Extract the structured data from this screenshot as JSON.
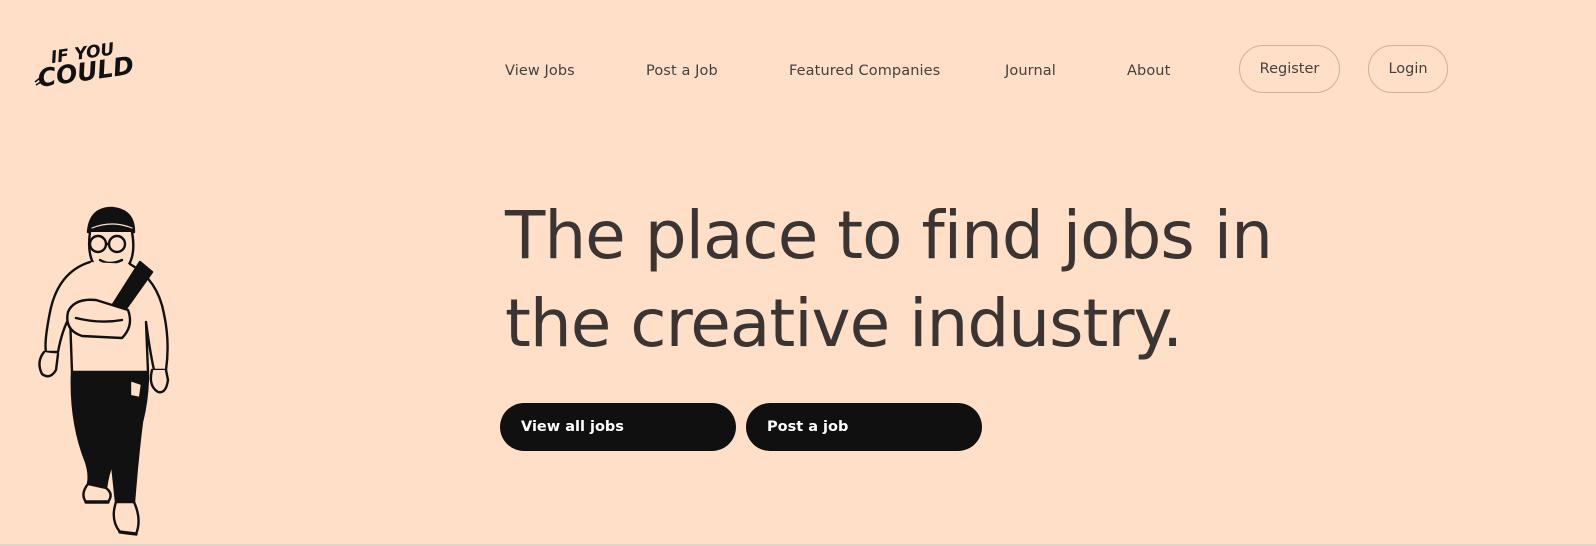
{
  "brand": {
    "logo_line1": "IF YOU",
    "logo_line2": "COULD"
  },
  "nav": {
    "links": [
      {
        "label": "View Jobs"
      },
      {
        "label": "Post a Job"
      },
      {
        "label": "Featured Companies"
      },
      {
        "label": "Journal"
      },
      {
        "label": "About"
      }
    ],
    "register_label": "Register",
    "login_label": "Login"
  },
  "hero": {
    "title_line1": "The place to find jobs in",
    "title_line2": "the creative industry.",
    "primary_cta": "View all jobs",
    "secondary_cta": "Post a job"
  },
  "colors": {
    "background": "#ffdfc7",
    "text": "#3a3532",
    "button": "#101010",
    "button_text": "#ffffff",
    "pill_border": "#c9b2a0"
  },
  "icons": {
    "illustration": "walking-man-illustration"
  }
}
